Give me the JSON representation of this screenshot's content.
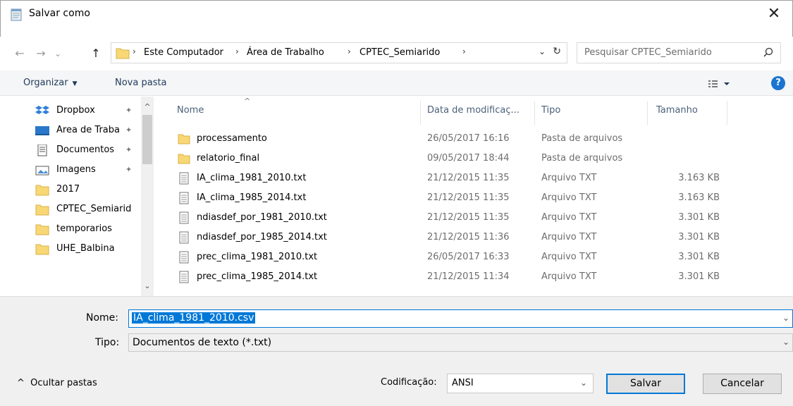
{
  "window": {
    "title": "Salvar como",
    "close_glyph": "✕"
  },
  "nav": {
    "back_glyph": "←",
    "forward_glyph": "→",
    "recent_glyph": "⌄",
    "up_glyph": "↑",
    "breadcrumbs": [
      "Este Computador",
      "Área de Trabalho",
      "CPTEC_Semiarido"
    ],
    "separator": "›",
    "dropdown_glyph": "⌄",
    "refresh_glyph": "↻",
    "search_placeholder": "Pesquisar CPTEC_Semiarido"
  },
  "toolbar": {
    "organize_label": "Organizar",
    "organize_caret": "▼",
    "new_folder_label": "Nova pasta",
    "help_glyph": "?"
  },
  "sidebar": {
    "items": [
      {
        "label": "Dropbox",
        "icon": "dropbox-icon",
        "pinned": true
      },
      {
        "label": "Área de Traba",
        "icon": "desktop-icon",
        "pinned": true
      },
      {
        "label": "Documentos",
        "icon": "documents-icon",
        "pinned": true
      },
      {
        "label": "Imagens",
        "icon": "pictures-icon",
        "pinned": true
      },
      {
        "label": "2017",
        "icon": "folder-icon",
        "pinned": false
      },
      {
        "label": "CPTEC_Semiarid",
        "icon": "folder-icon",
        "pinned": false
      },
      {
        "label": "temporarios",
        "icon": "folder-icon",
        "pinned": false
      },
      {
        "label": "UHE_Balbina",
        "icon": "folder-icon",
        "pinned": false
      }
    ],
    "pin_glyph": "📌",
    "scroll_up": "^",
    "scroll_down": "⌄"
  },
  "filelist": {
    "columns": {
      "name": "Nome",
      "date": "Data de modificaç...",
      "type": "Tipo",
      "size": "Tamanho"
    },
    "sort_glyph": "^",
    "rows": [
      {
        "name": "processamento",
        "date": "26/05/2017 16:16",
        "type": "Pasta de arquivos",
        "size": "",
        "icon": "folder-icon"
      },
      {
        "name": "relatorio_final",
        "date": "09/05/2017 18:44",
        "type": "Pasta de arquivos",
        "size": "",
        "icon": "folder-icon"
      },
      {
        "name": "IA_clima_1981_2010.txt",
        "date": "21/12/2015 11:35",
        "type": "Arquivo TXT",
        "size": "3.163 KB",
        "icon": "text-file-icon"
      },
      {
        "name": "IA_clima_1985_2014.txt",
        "date": "21/12/2015 11:35",
        "type": "Arquivo TXT",
        "size": "3.163 KB",
        "icon": "text-file-icon"
      },
      {
        "name": "ndiasdef_por_1981_2010.txt",
        "date": "21/12/2015 11:35",
        "type": "Arquivo TXT",
        "size": "3.301 KB",
        "icon": "text-file-icon"
      },
      {
        "name": "ndiasdef_por_1985_2014.txt",
        "date": "21/12/2015 11:36",
        "type": "Arquivo TXT",
        "size": "3.301 KB",
        "icon": "text-file-icon"
      },
      {
        "name": "prec_clima_1981_2010.txt",
        "date": "26/05/2017 16:33",
        "type": "Arquivo TXT",
        "size": "3.301 KB",
        "icon": "text-file-icon"
      },
      {
        "name": "prec_clima_1985_2014.txt",
        "date": "21/12/2015 11:34",
        "type": "Arquivo TXT",
        "size": "3.301 KB",
        "icon": "text-file-icon"
      }
    ]
  },
  "form": {
    "name_label": "Nome:",
    "name_value": "IA_clima_1981_2010.csv",
    "type_label": "Tipo:",
    "type_value": "Documentos de texto (*.txt)",
    "encoding_label": "Codificação:",
    "encoding_value": "ANSI",
    "combo_glyph": "⌄",
    "hide_folders_glyph": "^",
    "hide_folders_label": "Ocultar pastas",
    "save_label": "Salvar",
    "cancel_label": "Cancelar"
  },
  "colors": {
    "accent": "#0078d7",
    "folder": "#f8d775",
    "help": "#1b74d1",
    "toolbar_bg": "#f5f6f7",
    "bottom_bg": "#f0f0f0"
  }
}
